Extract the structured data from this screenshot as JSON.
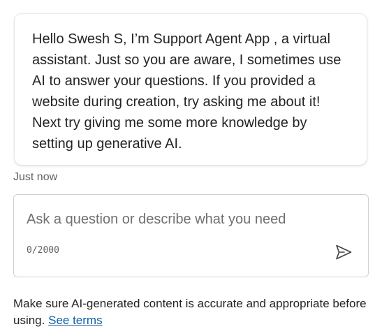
{
  "message": {
    "text": "Hello Swesh S, I’m Support Agent App , a virtual assistant. Just so you are aware, I sometimes use AI to answer your questions. If you provided a website during creation, try asking me about it! Next try giving me some more knowledge by setting up generative AI.",
    "timestamp": "Just now"
  },
  "composer": {
    "placeholder": "Ask a question or describe what you need",
    "value": "",
    "char_count": "0/2000",
    "send_icon": "send-icon"
  },
  "footer": {
    "disclaimer": "Make sure AI-generated content is accurate and appropriate before using.",
    "terms_link": "See terms"
  }
}
